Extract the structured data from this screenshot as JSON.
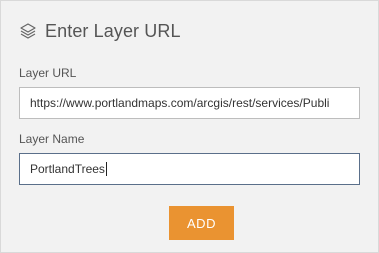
{
  "header": {
    "icon": "layers-icon",
    "title": "Enter Layer URL"
  },
  "form": {
    "url_label": "Layer URL",
    "url_value": "https://www.portlandmaps.com/arcgis/rest/services/Publi",
    "name_label": "Layer Name",
    "name_value": "PortlandTrees"
  },
  "actions": {
    "add_label": "ADD"
  },
  "colors": {
    "accent": "#ea9331",
    "panel_bg": "#f2f2f2",
    "text": "#555555"
  }
}
